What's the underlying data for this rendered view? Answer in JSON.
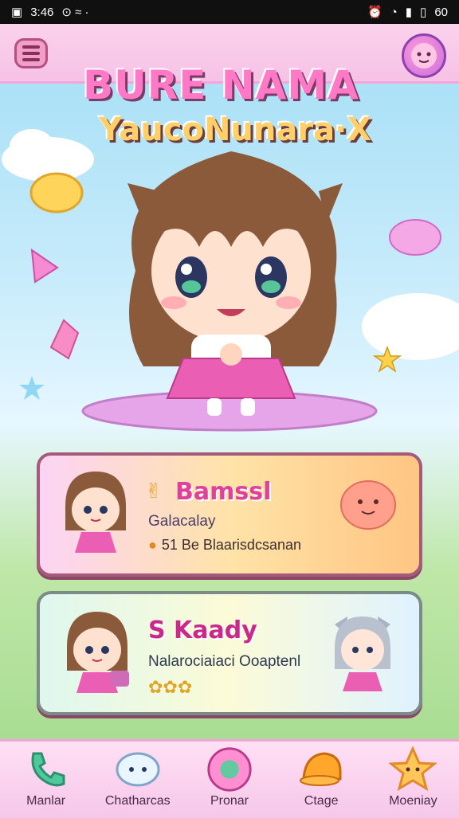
{
  "status": {
    "left_text": "3:46",
    "right_text": "60"
  },
  "title": {
    "main": "BURE NAMA",
    "subtitle": "YaucoNunara·X"
  },
  "cards": [
    {
      "name": "Bamssl",
      "subtitle": "Galacalay",
      "stat": "51 Be Blaarisdcsanan"
    },
    {
      "name": "S Kaady",
      "subtitle": "Nalarociaiaci Ooaptenl",
      "stat": ""
    }
  ],
  "nav": [
    {
      "label": "Manlar",
      "icon": "phone-icon"
    },
    {
      "label": "Chatharcas",
      "icon": "chat-bubble-icon"
    },
    {
      "label": "Pronar",
      "icon": "heart-circle-icon"
    },
    {
      "label": "Ctage",
      "icon": "hat-icon"
    },
    {
      "label": "Moeniay",
      "icon": "star-icon"
    }
  ],
  "colors": {
    "accent": "#ff79c6",
    "nav_bg": "#f6c7ea"
  }
}
